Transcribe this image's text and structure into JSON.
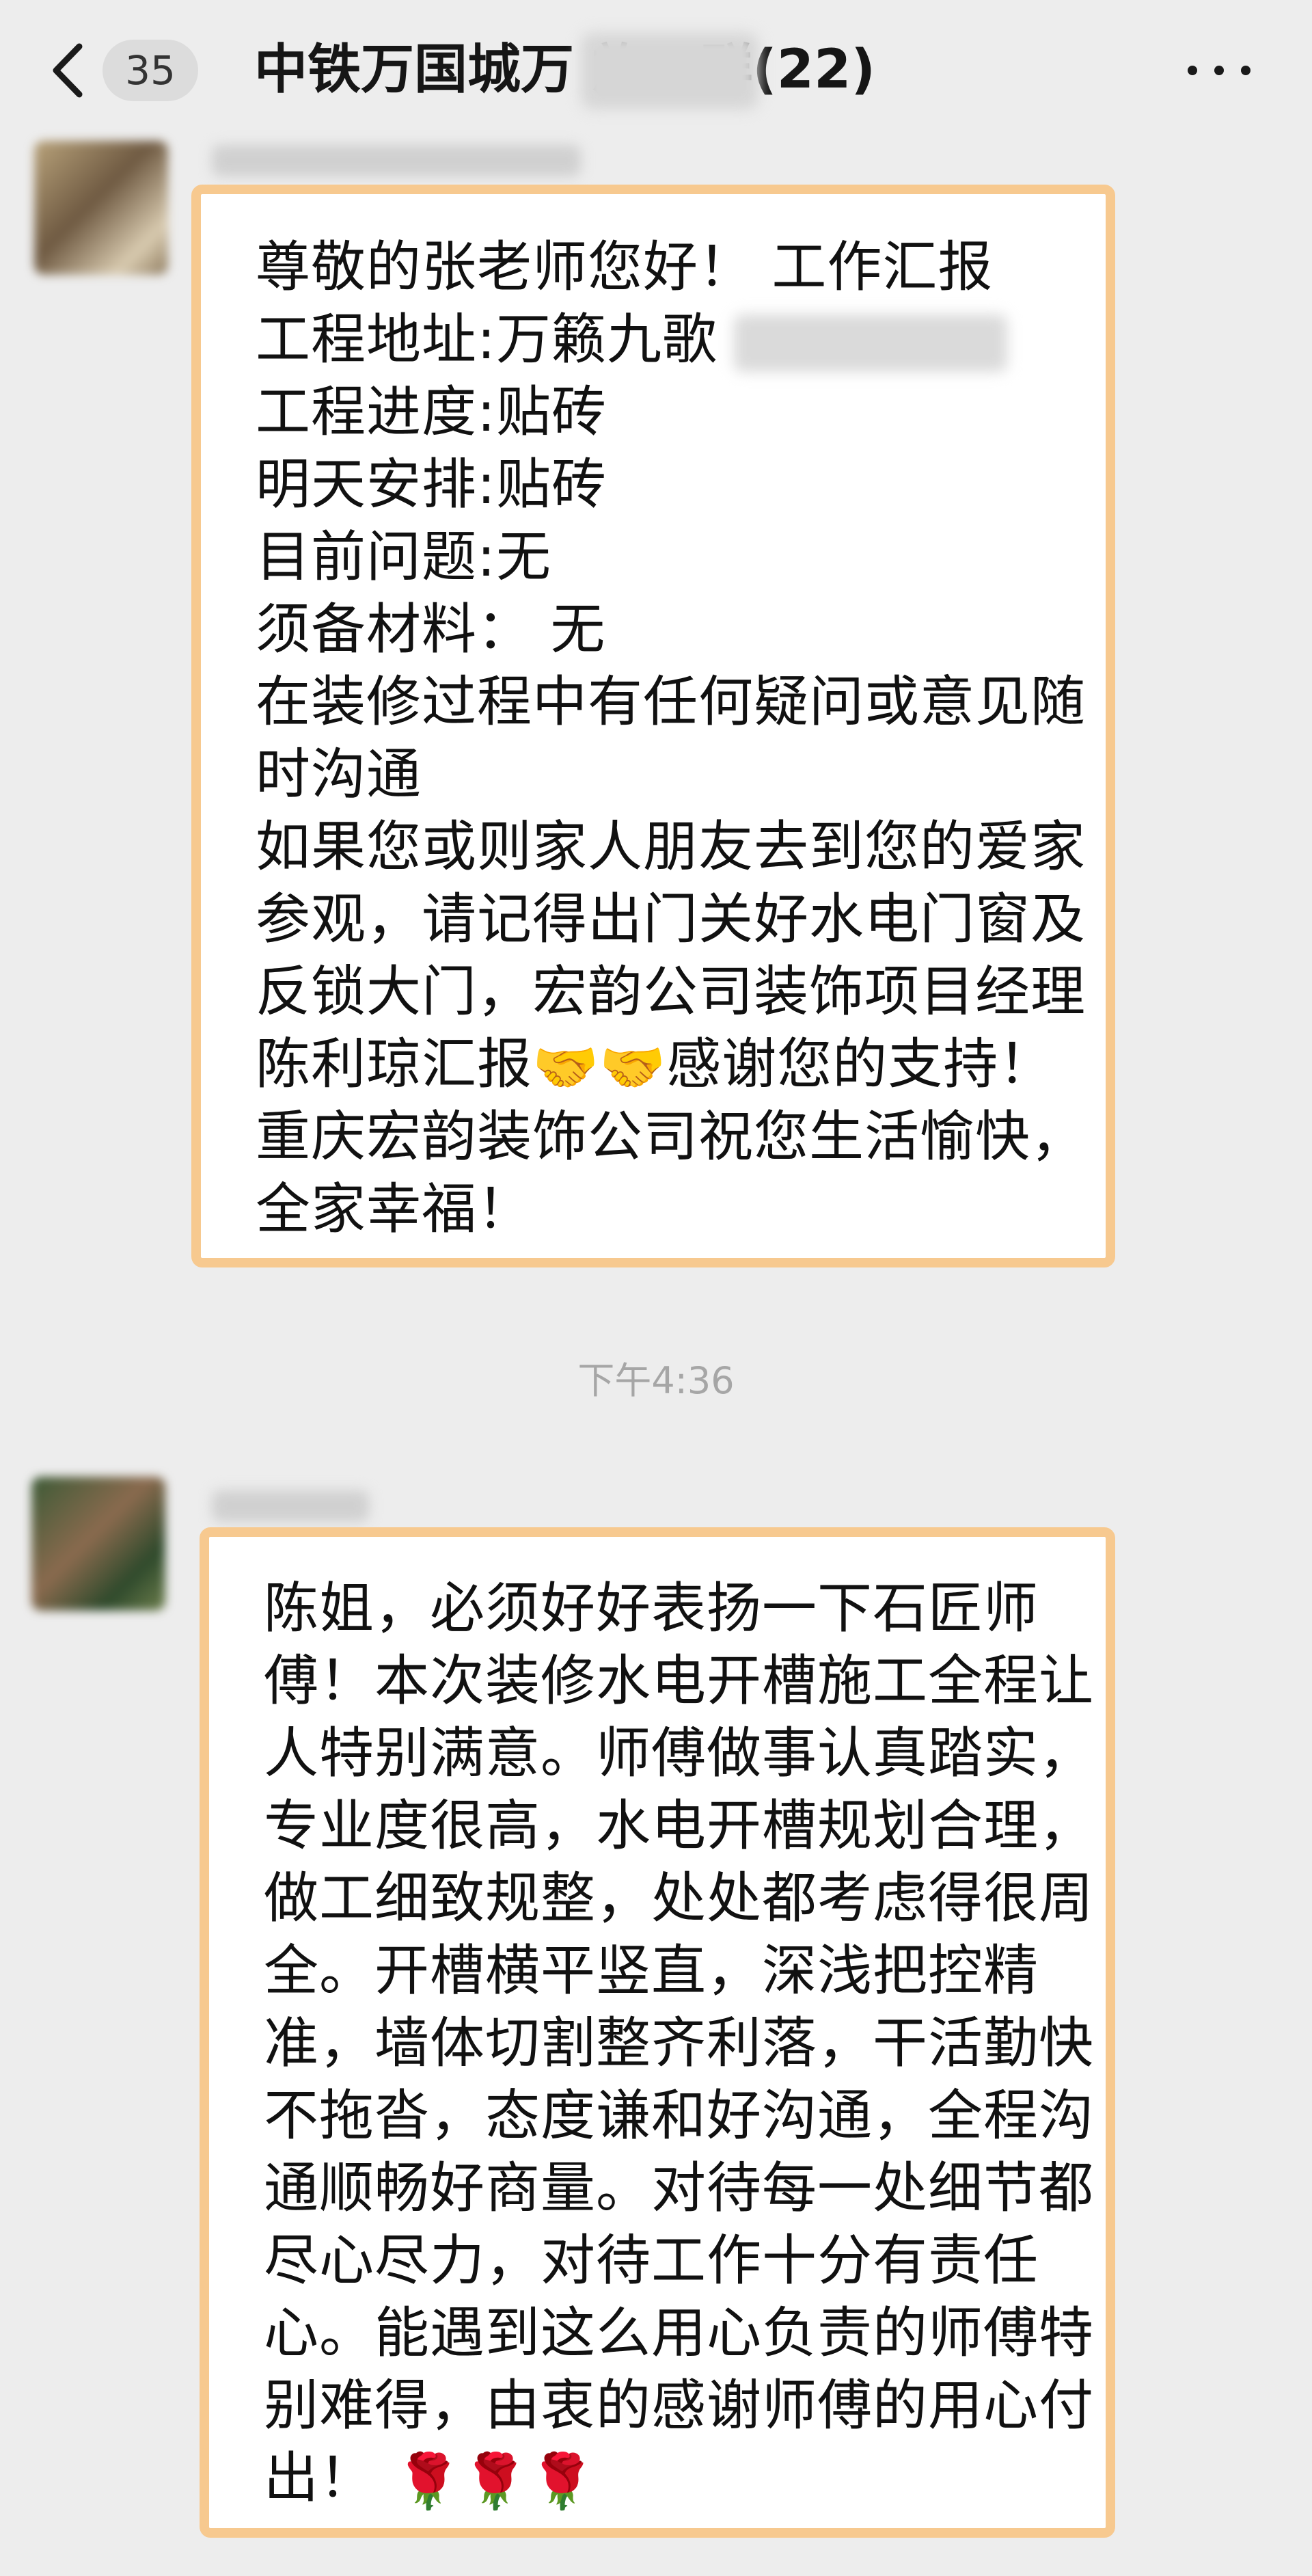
{
  "header": {
    "unread_count": "35",
    "title": "中铁万国城万  施工群(22)"
  },
  "messages": [
    {
      "lines": [
        "尊敬的张老师您好！ 工作汇报",
        "工程地址:万籁九歌",
        "工程进度:贴砖",
        "明天安排:贴砖",
        "目前问题:无",
        "须备材料： 无",
        "在装修过程中有任何疑问或意见随",
        "时沟通",
        "如果您或则家人朋友去到您的爱家",
        "参观，请记得出门关好水电门窗及",
        "反锁大门，宏韵公司装饰项目经理",
        "陈利琼汇报",
        "感谢您的支持！",
        "重庆宏韵装饰公司祝您生活愉快，",
        "全家幸福！"
      ],
      "emoji": "🤝🤝"
    },
    {
      "timestamp": "下午4:36",
      "lines": [
        "陈姐，必须好好表扬一下石匠师",
        "傅！本次装修水电开槽施工全程让",
        "人特别满意。师傅做事认真踏实，",
        "专业度很高，水电开槽规划合理，",
        "做工细致规整，处处都考虑得很周",
        "全。开槽横平竖直，深浅把控精",
        "准，墙体切割整齐利落，干活勤快",
        "不拖沓，态度谦和好沟通，全程沟",
        "通顺畅好商量。对待每一处细节都",
        "尽心尽力，对待工作十分有责任",
        "心。能遇到这么用心负责的师傅特",
        "别难得，由衷的感谢师傅的用心付",
        "出！"
      ],
      "emoji": "🌹🌹🌹"
    }
  ],
  "icons": {
    "back": "chevron-left-icon",
    "more": "more-dots-icon"
  }
}
